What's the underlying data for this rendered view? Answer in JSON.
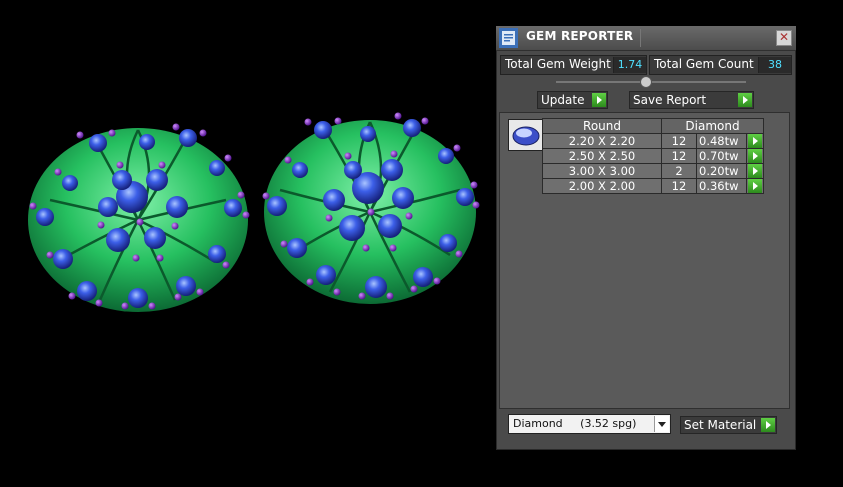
{
  "window": {
    "title": "GEM REPORTER",
    "close_icon": "close-icon",
    "app_icon": "report-icon"
  },
  "stats": {
    "total_weight_label": "Total Gem Weight",
    "total_weight_value": "1.74",
    "total_count_label": "Total Gem Count",
    "total_count_value": "38"
  },
  "toolbar": {
    "update_label": "Update",
    "save_label": "Save Report"
  },
  "gem_table": {
    "headers": [
      "Round",
      "Diamond"
    ],
    "rows": [
      {
        "size": "2.20 X 2.20",
        "count": "12",
        "weight": "0.48tw"
      },
      {
        "size": "2.50 X 2.50",
        "count": "12",
        "weight": "0.70tw"
      },
      {
        "size": "3.00 X 3.00",
        "count": "2",
        "weight": "0.20tw"
      },
      {
        "size": "2.00 X 2.00",
        "count": "12",
        "weight": "0.36tw"
      }
    ]
  },
  "material": {
    "selected": "Diamond     (3.52 spg)",
    "set_label": "Set Material"
  },
  "colors": {
    "value_text": "#4fe0ff",
    "go_button": "#3fae2a",
    "gem_blue": "#2a3fc8",
    "metal_green": "#26c060"
  }
}
